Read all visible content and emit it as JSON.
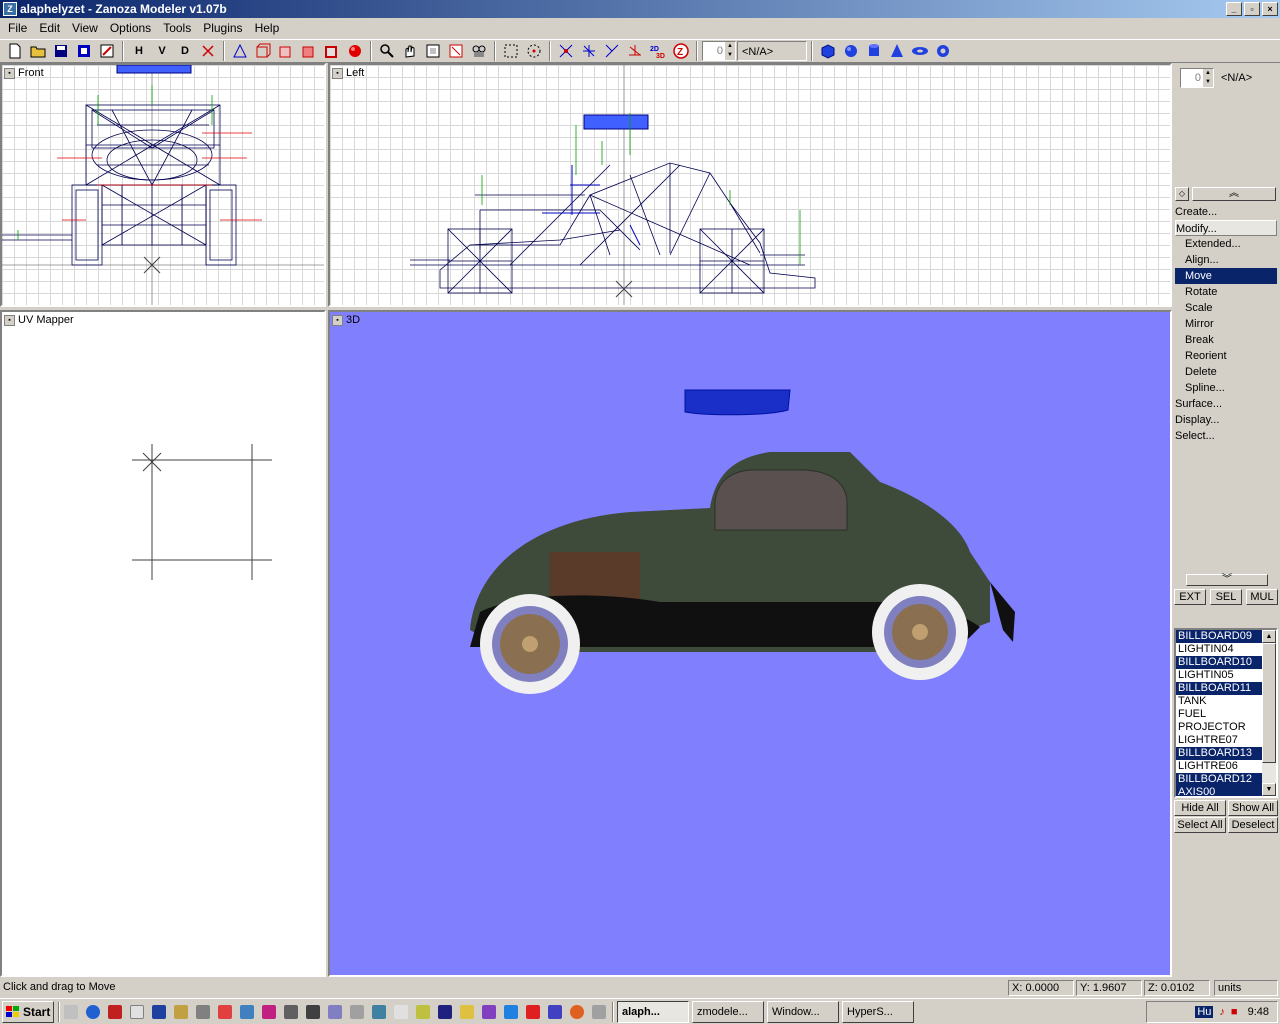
{
  "window": {
    "title": "alaphelyzet - Zanoza Modeler v1.07b"
  },
  "menu": [
    "File",
    "Edit",
    "View",
    "Options",
    "Tools",
    "Plugins",
    "Help"
  ],
  "toolbar": {
    "h_label": "H",
    "v_label": "V",
    "d_label": "D",
    "spin_value": "0",
    "spin_text": "<N/A>",
    "icons": [
      "new-file",
      "open-folder",
      "save",
      "save-as",
      "export",
      "select-rect",
      "select-circle",
      "zoom",
      "pan",
      "cube",
      "sphere",
      "cylinder",
      "cone",
      "torus"
    ]
  },
  "viewports": {
    "front": "Front",
    "left": "Left",
    "uv": "UV Mapper",
    "threed": "3D"
  },
  "panel": {
    "spin_value": "0",
    "spin_text": "<N/A>",
    "items": [
      {
        "label": "Create...",
        "level": 0
      },
      {
        "label": "Modify...",
        "level": 0
      },
      {
        "label": "Extended...",
        "level": 1
      },
      {
        "label": "Align...",
        "level": 1
      },
      {
        "label": "Move",
        "level": 1
      },
      {
        "label": "Rotate",
        "level": 1
      },
      {
        "label": "Scale",
        "level": 1
      },
      {
        "label": "Mirror",
        "level": 1
      },
      {
        "label": "Break",
        "level": 1
      },
      {
        "label": "Reorient",
        "level": 1
      },
      {
        "label": "Delete",
        "level": 1
      },
      {
        "label": "Spline...",
        "level": 1
      },
      {
        "label": "Surface...",
        "level": 0
      },
      {
        "label": "Display...",
        "level": 0
      },
      {
        "label": "Select...",
        "level": 0
      }
    ],
    "selected_item": "Move",
    "mode_buttons": [
      "EXT",
      "SEL",
      "MUL"
    ],
    "objects": [
      {
        "name": "BILLBOARD09",
        "selected": true
      },
      {
        "name": "LIGHTIN04",
        "selected": false
      },
      {
        "name": "BILLBOARD10",
        "selected": true
      },
      {
        "name": "LIGHTIN05",
        "selected": false
      },
      {
        "name": "BILLBOARD11",
        "selected": true
      },
      {
        "name": "TANK",
        "selected": false
      },
      {
        "name": "FUEL",
        "selected": false
      },
      {
        "name": "PROJECTOR",
        "selected": false
      },
      {
        "name": "LIGHTRE07",
        "selected": false
      },
      {
        "name": "BILLBOARD13",
        "selected": true
      },
      {
        "name": "LIGHTRE06",
        "selected": false
      },
      {
        "name": "BILLBOARD12",
        "selected": true
      },
      {
        "name": "AXIS00",
        "selected": true
      }
    ],
    "hide_all": "Hide All",
    "show_all": "Show All",
    "select_all": "Select All",
    "deselect": "Deselect"
  },
  "status": {
    "message": "Click and drag to Move",
    "x": "X: 0.0000",
    "y": "Y: 1.9607",
    "z": "Z: 0.0102",
    "units": "units"
  },
  "taskbar": {
    "start": "Start",
    "tasks": [
      {
        "label": "alaph...",
        "active": true
      },
      {
        "label": "zmodele...",
        "active": false
      },
      {
        "label": "Window...",
        "active": false
      },
      {
        "label": "HyperS...",
        "active": false
      }
    ],
    "clock": "9:48",
    "tray_text": "Hu"
  },
  "colors": {
    "titlebar": "#0a246a",
    "viewport3d": "#8080ff",
    "wire": "#000060",
    "car_body": "#3e4a3a"
  }
}
